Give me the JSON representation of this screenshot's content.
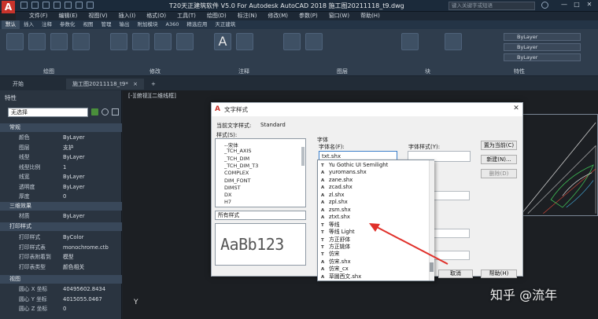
{
  "titlebar": {
    "logo": "A",
    "title": "T20天正建筑软件 V5.0 For Autodesk AutoCAD 2018    施工图20211118_t9.dwg",
    "search_placeholder": "键入关键字或短语",
    "win_min": "—",
    "win_max": "□",
    "win_close": "✕"
  },
  "menubar": [
    "文件(F)",
    "编辑(E)",
    "视图(V)",
    "插入(I)",
    "格式(O)",
    "工具(T)",
    "绘图(D)",
    "标注(N)",
    "修改(M)",
    "参数(P)",
    "窗口(W)",
    "帮助(H)"
  ],
  "ribbon_tabs": [
    "默认",
    "插入",
    "注释",
    "参数化",
    "视图",
    "管理",
    "输出",
    "附加模块",
    "A360",
    "精选应用",
    "天正建筑"
  ],
  "ribbon_panels": [
    "绘图",
    "修改",
    "注释",
    "图层",
    "块",
    "特性"
  ],
  "ribbon_props": [
    "ByLayer",
    "ByLayer",
    "ByLayer"
  ],
  "doc_tabs": {
    "start": "开始",
    "drawing": "施工图20211118_t9*",
    "close": "×",
    "add": "+"
  },
  "properties": {
    "title": "特性",
    "selection": "无选择",
    "sections": {
      "general": "常规",
      "three_d": "三维效果",
      "print": "打印样式",
      "view": "视图"
    },
    "general_rows": [
      {
        "label": "颜色",
        "value": "ByLayer"
      },
      {
        "label": "图层",
        "value": "支护"
      },
      {
        "label": "线型",
        "value": "ByLayer"
      },
      {
        "label": "线型比例",
        "value": "1"
      },
      {
        "label": "线宽",
        "value": "ByLayer"
      },
      {
        "label": "透明度",
        "value": "ByLayer"
      },
      {
        "label": "厚度",
        "value": "0"
      }
    ],
    "three_d_rows": [
      {
        "label": "材质",
        "value": "ByLayer"
      }
    ],
    "print_rows": [
      {
        "label": "打印样式",
        "value": "ByColor"
      },
      {
        "label": "打印样式表",
        "value": "monochrome.ctb"
      },
      {
        "label": "打印表附着到",
        "value": "模型"
      },
      {
        "label": "打印表类型",
        "value": "颜色相关"
      }
    ],
    "view_rows": [
      {
        "label": "圆心 X 坐标",
        "value": "40495602.8434"
      },
      {
        "label": "圆心 Y 坐标",
        "value": "4015055.0467"
      },
      {
        "label": "圆心 Z 坐标",
        "value": "0"
      }
    ]
  },
  "viewport_label": "[-][俯视][二维线框]",
  "dialog": {
    "title": "文字样式",
    "close": "✕",
    "current_style_label": "当前文字样式:",
    "current_style_value": "Standard",
    "styles_label": "样式(S):",
    "styles": [
      "--宋体",
      "_TCH_AXIS",
      "_TCH_DIM",
      "_TCH_DIM_T3",
      "COMPLEX",
      "DIM_FONT",
      "DIMST",
      "DX",
      "H7"
    ],
    "all_styles": "所有样式",
    "preview_text": "AaBb123",
    "font_group": "字体",
    "font_name_label": "字体名(F):",
    "font_name_value": "txt.shx",
    "font_style_label": "字体样式(Y):",
    "btn_set_current": "置为当前(C)",
    "btn_new": "新建(N)...",
    "btn_delete": "删除(D)",
    "btn_cancel": "取消",
    "btn_help": "帮助(H)",
    "font_list": [
      {
        "icon": "T",
        "name": "Yu Gothic UI Semilight"
      },
      {
        "icon": "A",
        "name": "yuromans.shx"
      },
      {
        "icon": "A",
        "name": "zane.shx"
      },
      {
        "icon": "A",
        "name": "zcad.shx"
      },
      {
        "icon": "A",
        "name": "zl.shx"
      },
      {
        "icon": "A",
        "name": "zpl.shx"
      },
      {
        "icon": "A",
        "name": "zsm.shx"
      },
      {
        "icon": "A",
        "name": "ztxt.shx"
      },
      {
        "icon": "T",
        "name": "等线"
      },
      {
        "icon": "T",
        "name": "等线 Light"
      },
      {
        "icon": "T",
        "name": "方正舒体"
      },
      {
        "icon": "T",
        "name": "方正姚体"
      },
      {
        "icon": "T",
        "name": "仿宋"
      },
      {
        "icon": "A",
        "name": "仿宋.shx"
      },
      {
        "icon": "A",
        "name": "仿宋_cx"
      },
      {
        "icon": "A",
        "name": "草圖西文.shx"
      }
    ]
  },
  "watermark": "知乎 @流年",
  "axis_y": "Y",
  "colors": {
    "accent": "#c8332b",
    "arrow": "#e0302a"
  }
}
